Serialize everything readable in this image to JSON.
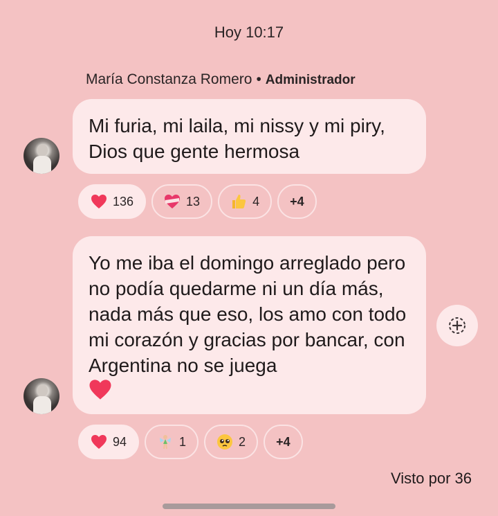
{
  "timestamp": "Hoy 10:17",
  "sender": {
    "name": "María Constanza Romero",
    "separator": "•",
    "role": "Administrador"
  },
  "messages": [
    {
      "text": "Mi furia, mi laila, mi nissy y mi piry, Dios que gente hermosa",
      "reactions": [
        {
          "icon": "red-heart",
          "count": "136",
          "selected": true
        },
        {
          "icon": "heart-with-ribbon",
          "count": "13",
          "selected": false
        },
        {
          "icon": "thumbs-up",
          "count": "4",
          "selected": false
        },
        {
          "more": "+4"
        }
      ]
    },
    {
      "text": "Yo me iba el domingo arreglado pero no podía quedarme ni un día más, nada más que eso, los amo con todo mi corazón y gracias por bancar, con Argentina no se juega",
      "trailing_emoji": "red-heart",
      "reactions": [
        {
          "icon": "red-heart",
          "count": "94",
          "selected": true
        },
        {
          "icon": "fairy",
          "count": "1",
          "selected": false
        },
        {
          "icon": "pleading-face",
          "count": "2",
          "selected": false
        },
        {
          "more": "+4"
        }
      ]
    }
  ],
  "seen_by": "Visto por 36",
  "colors": {
    "background": "#f4c2c3",
    "bubble": "#fde9ea",
    "heart": "#f0385a"
  }
}
